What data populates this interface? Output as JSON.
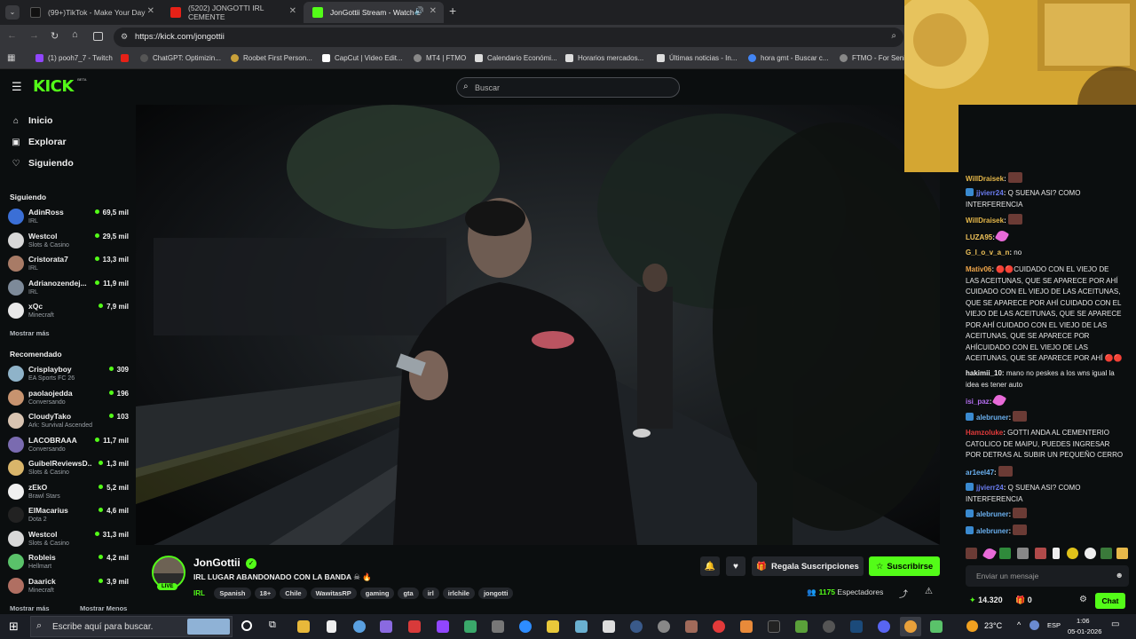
{
  "browser": {
    "tabs": [
      {
        "title": "(99+)TikTok - Make Your Day",
        "active": false
      },
      {
        "title": "(5202) JONGOTTI IRL CEMENTE",
        "active": false
      },
      {
        "title": "JonGottii Stream - Watch L",
        "active": true
      }
    ],
    "url": "https://kick.com/jongottii",
    "bookmarks": [
      "(1) pooh7_7 - Twitch",
      "ChatGPT: Optimizin...",
      "Roobet First Person...",
      "CapCut | Video Edit...",
      "MT4 | FTMO",
      "Calendario Económi...",
      "Horarios mercados...",
      "Últimas noticias - In...",
      "hora gmt - Buscar c...",
      "FTMO - For Senio"
    ]
  },
  "kick": {
    "logo": "KICK",
    "beta": "BETA",
    "search_placeholder": "Buscar"
  },
  "sidebar": {
    "nav": [
      {
        "label": "Inicio",
        "icon": "home-icon"
      },
      {
        "label": "Explorar",
        "icon": "compass-icon"
      },
      {
        "label": "Siguiendo",
        "icon": "heart-icon"
      }
    ],
    "following_title": "Siguiendo",
    "following": [
      {
        "name": "AdinRoss",
        "category": "IRL",
        "viewers": "69,5 mil",
        "color": "#3b6fd6"
      },
      {
        "name": "Westcol",
        "category": "Slots & Casino",
        "viewers": "29,5 mil",
        "color": "#d8d8d8"
      },
      {
        "name": "Cristorata7",
        "category": "IRL",
        "viewers": "13,3 mil",
        "color": "#a87b66"
      },
      {
        "name": "Adrianozendej...",
        "category": "IRL",
        "viewers": "11,9 mil",
        "color": "#7d8a99"
      },
      {
        "name": "xQc",
        "category": "Minecraft",
        "viewers": "7,9 mil",
        "color": "#e8e8e8"
      }
    ],
    "show_more": "Mostrar más",
    "recommended_title": "Recomendado",
    "recommended": [
      {
        "name": "Crisplayboy",
        "category": "EA Sports FC 26",
        "viewers": "309",
        "color": "#8fb3c9"
      },
      {
        "name": "paolaojedda",
        "category": "Conversando",
        "viewers": "196",
        "color": "#c7936f"
      },
      {
        "name": "CloudyTako",
        "category": "Ark: Survival Ascended",
        "viewers": "103",
        "color": "#d9c4b1"
      },
      {
        "name": "LACOBRAAA",
        "category": "Conversando",
        "viewers": "11,7 mil",
        "color": "#7a6bb0"
      },
      {
        "name": "GuibelReviewsD...",
        "category": "Slots & Casino",
        "viewers": "1,3 mil",
        "color": "#d9b56a"
      },
      {
        "name": "zEkO",
        "category": "Brawl Stars",
        "viewers": "5,2 mil",
        "color": "#f0f0f0"
      },
      {
        "name": "ElMacarius",
        "category": "Dota 2",
        "viewers": "4,6 mil",
        "color": "#222222"
      },
      {
        "name": "Westcol",
        "category": "Slots & Casino",
        "viewers": "31,3 mil",
        "color": "#d8d8d8"
      },
      {
        "name": "Robleis",
        "category": "Hellmart",
        "viewers": "4,2 mil",
        "color": "#5ac26a"
      },
      {
        "name": "Daarick",
        "category": "Minecraft",
        "viewers": "3,9 mil",
        "color": "#b06f62"
      }
    ],
    "show_more_2": "Mostrar más",
    "show_less": "Mostrar Menos"
  },
  "stream": {
    "channel": "JonGottii",
    "live_badge": "LIVE",
    "title": "IRL LUGAR ABANDONADO CON LA BANDA ☠ 🔥",
    "category": "IRL",
    "tags": [
      "Spanish",
      "18+",
      "Chile",
      "WawitasRP",
      "gaming",
      "gta",
      "irl",
      "irlchile",
      "jongotti"
    ],
    "gift_label": "Regala Suscripciones",
    "subscribe_label": "Suscribirse",
    "viewers_count": "1175",
    "viewers_label": "Espectadores"
  },
  "chat": {
    "messages": [
      {
        "user": "WillDraisek",
        "color": "#e6b84a",
        "text": "",
        "emote": true,
        "badge": false
      },
      {
        "user": "jjvierr24",
        "color": "#6a7cf0",
        "text": "Q SUENA ASI? COMO INTERFERENCIA",
        "emote": false,
        "badge": true
      },
      {
        "user": "WillDraisek",
        "color": "#e6b84a",
        "text": "",
        "emote": true,
        "badge": false
      },
      {
        "user": "LUZA95",
        "color": "#f0c35a",
        "text": "",
        "pink": true,
        "badge": false
      },
      {
        "user": "G_l_o_v_a_n",
        "color": "#f0c35a",
        "text": "no",
        "badge": false
      },
      {
        "user": "Mativ06",
        "color": "#f0a64a",
        "text": "🔴🔴CUIDADO CON EL VIEJO DE LAS ACEITUNAS, QUE SE APARECE POR AHÍ CUIDADO CON EL VIEJO DE LAS ACEITUNAS, QUE SE APARECE POR AHÍ CUIDADO CON EL VIEJO DE LAS ACEITUNAS, QUE SE APARECE POR AHÍ CUIDADO CON EL VIEJO DE LAS ACEITUNAS, QUE SE APARECE POR AHÍCUIDADO CON EL VIEJO DE LAS ACEITUNAS, QUE SE APARECE POR AHÍ 🔴🔴",
        "badge": false
      },
      {
        "user": "hakimii_10",
        "color": "#eeeeee",
        "text": "mano no peskes a los wns igual la idea es tener auto",
        "badge": false
      },
      {
        "user": "isi_paz",
        "color": "#b46ef0",
        "text": "",
        "pink": true,
        "badge": false
      },
      {
        "user": "alebruner",
        "color": "#6ab0f0",
        "text": "",
        "emote": true,
        "badge": true
      },
      {
        "user": "Hamzoluke",
        "color": "#e23b3b",
        "text": "GOTTI ANDA AL CEMENTERIO CATOLICO DE MAIPU, PUEDES INGRESAR POR DETRAS AL SUBIR UN PEQUEÑO CERRO",
        "badge": false
      },
      {
        "user": "ar1eel47",
        "color": "#6ab0f0",
        "text": "",
        "emote": true,
        "badge": false
      },
      {
        "user": "jjvierr24",
        "color": "#6a7cf0",
        "text": "Q SUENA ASI? COMO INTERFERENCIA",
        "badge": true
      },
      {
        "user": "alebruner",
        "color": "#6ab0f0",
        "text": "",
        "emote": true,
        "badge": true
      },
      {
        "user": "alebruner",
        "color": "#6ab0f0",
        "text": "",
        "emote": true,
        "badge": true
      }
    ],
    "input_placeholder": "Enviar un mensaje",
    "points": "14.320",
    "zero": "0",
    "chat_button": "Chat"
  },
  "taskbar": {
    "search_placeholder": "Escribe aquí para buscar.",
    "weather": "23°C",
    "lang": "ESP",
    "time": "1:06",
    "date": "05-01-2026"
  }
}
